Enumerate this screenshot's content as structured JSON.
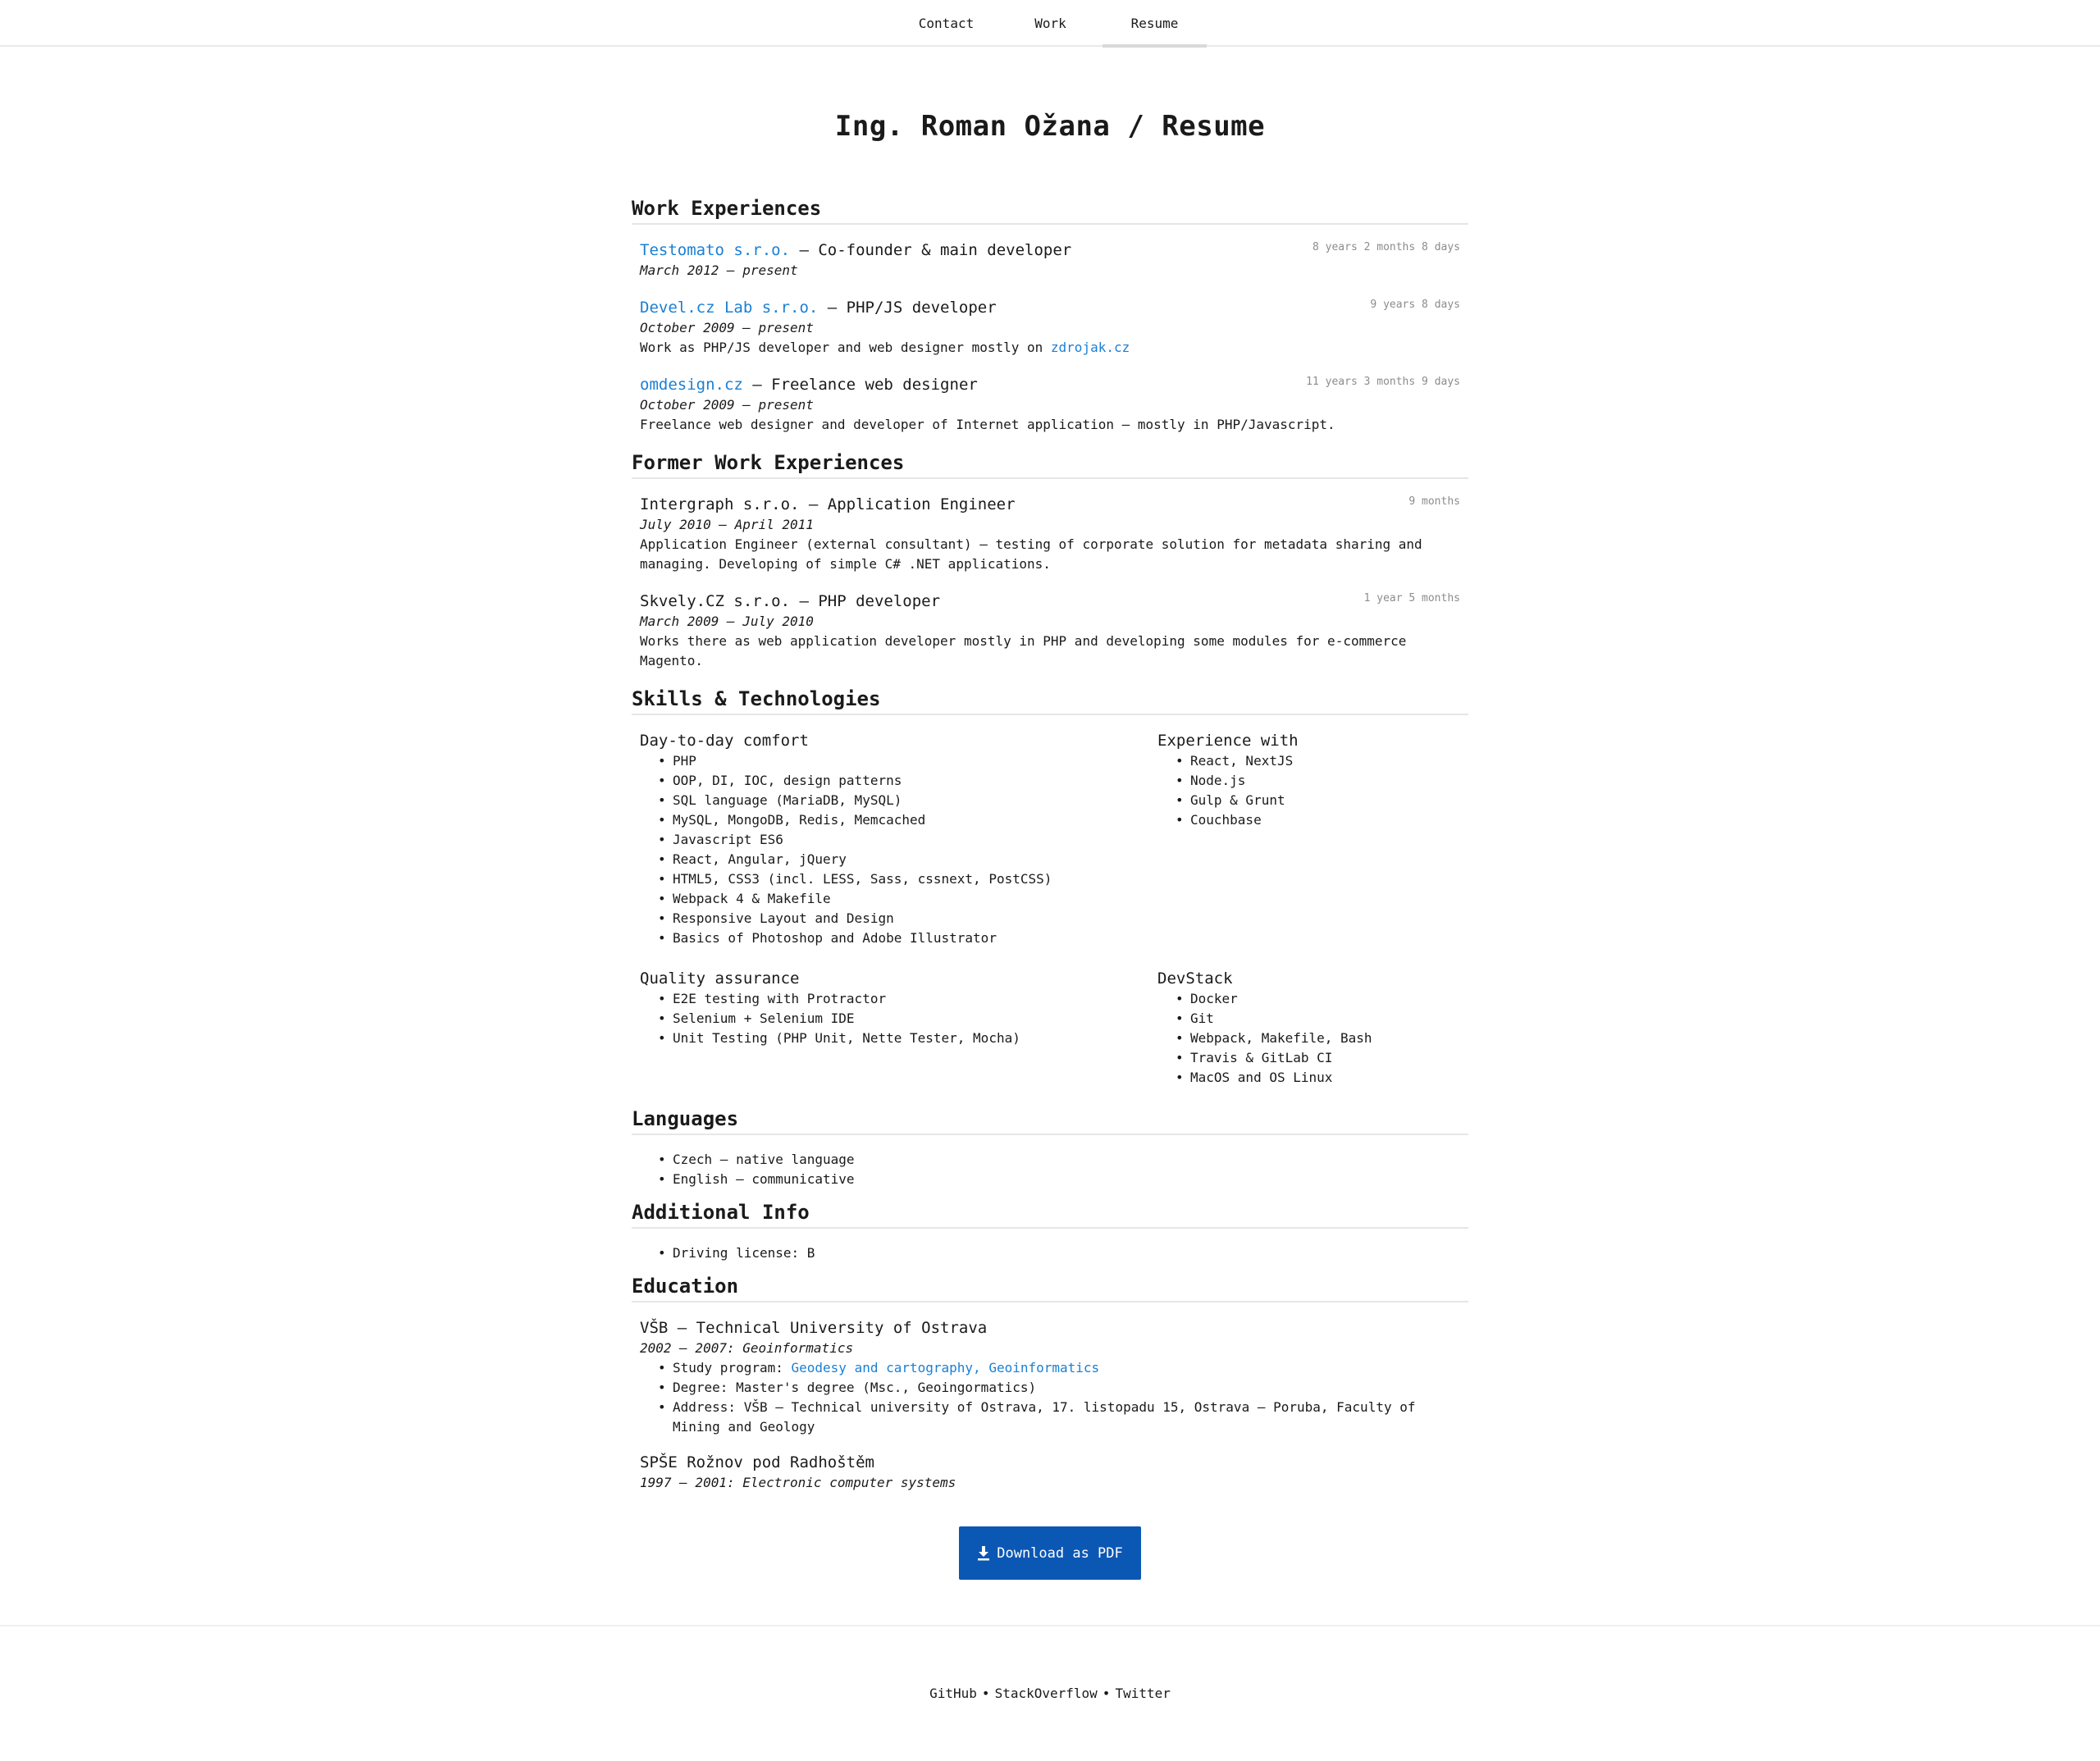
{
  "nav": {
    "tabs": [
      {
        "label": "Contact"
      },
      {
        "label": "Work"
      },
      {
        "label": "Resume"
      }
    ]
  },
  "page": {
    "title": "Ing. Roman Ožana / Resume"
  },
  "work": {
    "title": "Work Experiences",
    "jobs": [
      {
        "company": "Testomato s.r.o.",
        "role": " — Co-founder & main developer",
        "date": "March 2012 — present",
        "duration": "8 years 2 months 8 days"
      },
      {
        "company": "Devel.cz Lab s.r.o.",
        "role": " — PHP/JS developer",
        "date": "October 2009 — present",
        "duration": "9 years 8 days",
        "desc": "Work as PHP/JS developer and web designer mostly on ",
        "desc_link": "zdrojak.cz"
      },
      {
        "company": "omdesign.cz",
        "role": " — Freelance web designer",
        "date": "October 2009 — present",
        "duration": "11 years 3 months 9 days",
        "desc": "Freelance web designer and developer of Internet application — mostly in PHP/Javascript."
      }
    ]
  },
  "former": {
    "title": "Former Work Experiences",
    "jobs": [
      {
        "head": "Intergraph s.r.o. — Application Engineer",
        "date": "July 2010 — April 2011",
        "duration": "9 months",
        "desc": "Application Engineer (external consultant) — testing of corporate solution for metadata sharing and managing. Developing of simple C# .NET applications."
      },
      {
        "head": "Skvely.CZ s.r.o. — PHP developer",
        "date": "March 2009 — July 2010",
        "duration": "1 year 5 months",
        "desc": "Works there as web application developer mostly in PHP and developing some modules for e-commerce Magento."
      }
    ]
  },
  "skills": {
    "title": "Skills & Technologies",
    "groups": [
      {
        "title": "Day-to-day comfort",
        "items": [
          "PHP",
          "OOP, DI, IOC, design patterns",
          "SQL language (MariaDB, MySQL)",
          "MySQL, MongoDB, Redis, Memcached",
          "Javascript ES6",
          "React, Angular, jQuery",
          "HTML5, CSS3 (incl. LESS, Sass, cssnext, PostCSS)",
          "Webpack 4 & Makefile",
          "Responsive Layout and Design",
          "Basics of Photoshop and Adobe Illustrator"
        ]
      },
      {
        "title": "Experience with",
        "items": [
          "React, NextJS",
          "Node.js",
          "Gulp & Grunt",
          "Couchbase"
        ]
      },
      {
        "title": "Quality assurance",
        "items": [
          "E2E testing with Protractor",
          "Selenium + Selenium IDE",
          "Unit Testing (PHP Unit, Nette Tester, Mocha)"
        ]
      },
      {
        "title": "DevStack",
        "items": [
          "Docker",
          "Git",
          "Webpack, Makefile, Bash",
          "Travis & GitLab CI",
          "MacOS and OS Linux"
        ]
      }
    ]
  },
  "languages": {
    "title": "Languages",
    "items": [
      "Czech — native language",
      "English — communicative"
    ]
  },
  "additional": {
    "title": "Additional Info",
    "items": [
      "Driving license: B"
    ]
  },
  "education": {
    "title": "Education",
    "schools": [
      {
        "school": "VŠB – Technical University of Ostrava",
        "date": "2002 — 2007: Geoinformatics",
        "program_label": "Study program: ",
        "program_link": "Geodesy and cartography, Geoinformatics",
        "degree": "Degree: Master's degree (Msc., Geoingormatics)",
        "address": "Address: VŠB – Technical university of Ostrava, 17. listopadu 15, Ostrava – Poruba, Faculty of Mining and Geology"
      },
      {
        "school": "SPŠE Rožnov pod Radhoštěm",
        "date": "1997 — 2001: Electronic computer systems"
      }
    ]
  },
  "download": {
    "label": "Download as PDF",
    "icon": "download-icon",
    "color": "#0b57b4"
  },
  "footer": {
    "links": [
      "GitHub",
      "StackOverflow",
      "Twitter"
    ],
    "separator": "•"
  },
  "colors": {
    "link": "#1a7fd4",
    "text": "#1a1a1a",
    "muted": "#8c8c8c"
  }
}
